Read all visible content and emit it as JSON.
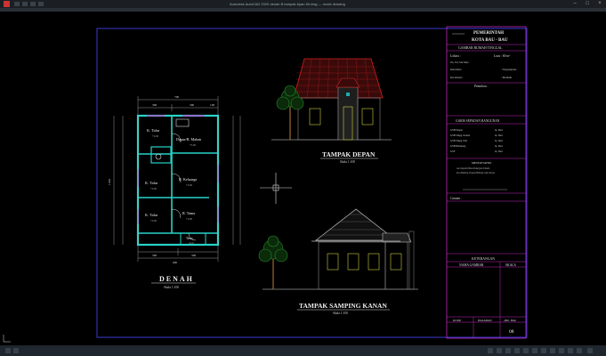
{
  "window": {
    "title": "Autodesk AutoCAD 2020   denah B tampak 6pan 60.dwg   — mode drawing",
    "controls": [
      "–",
      "□",
      "×"
    ]
  },
  "drawing": {
    "plan": {
      "title": "DENAH",
      "scale": "Skala 1:100",
      "dims_top": [
        "700",
        "300",
        "300",
        "100"
      ],
      "dims_bottom": [
        "600",
        "300",
        "300"
      ],
      "dim_left": "1100",
      "rooms": [
        {
          "name": "K. Tidur",
          "area": "+0.00"
        },
        {
          "name": "Dapur/R. Makan",
          "area": "+0.00"
        },
        {
          "name": "K. Tidur",
          "area": "+0.00"
        },
        {
          "name": "R. Keluarga",
          "area": "+0.00"
        },
        {
          "name": "K. Tidur",
          "area": "+0.00"
        },
        {
          "name": "R. Tamu",
          "area": "+0.00"
        },
        {
          "name": "Teras",
          "area": "-0.10"
        }
      ]
    },
    "front_view": {
      "title": "TAMPAK DEPAN",
      "scale": "Skala 1:100"
    },
    "side_view": {
      "title": "TAMPAK SAMPING KANAN",
      "scale": "Skala 1:100"
    }
  },
  "title_block": {
    "header": [
      "PEMERINTAH",
      "KOTA BAU - BAU"
    ],
    "subtitle": "GAMBAR RUMAH TINGGAL",
    "lokasi_label": "Lokasi :",
    "luas": "Luas : 60 m²",
    "address": "Jln. Yos Sdr Mau",
    "kelurahan_label": "Kelurahan",
    "kelurahan_value": ": Tanganapada",
    "kecamatan_label": "Kecamatan",
    "kecamatan_value": ": Murhum",
    "pemohon": "Pemohon :",
    "garis_title": "GARIS SEPADAN BANGUNAN",
    "garis_rows": [
      {
        "label": "GSB Depan",
        "value": "m, Dari"
      },
      {
        "label": "GSB Smpg. Kanan",
        "value": "m, Dari"
      },
      {
        "label": "GSB Smpg. Kiri",
        "value": "m, Dari"
      },
      {
        "label": "GSB Belakang",
        "value": "m, Dari"
      },
      {
        "label": "GSP",
        "value": "m, Dari"
      }
    ],
    "mengetahui": "MENGETAHUI",
    "mengetahui_lines": [
      "An. Kepala Dinas Pekerjaan Umum",
      "kota Baubau, Kapala Bidang Cipta Karya"
    ],
    "catatan": "Catatan :",
    "keterangan": "KETERANGAN",
    "col_nama": "NAMA GAMBAR",
    "col_skala": "SKALA",
    "footer_kode": "KODE",
    "footer_halaman": "HALAMAN",
    "footer_jml": "JML. HAL",
    "sheet_no": "08"
  }
}
